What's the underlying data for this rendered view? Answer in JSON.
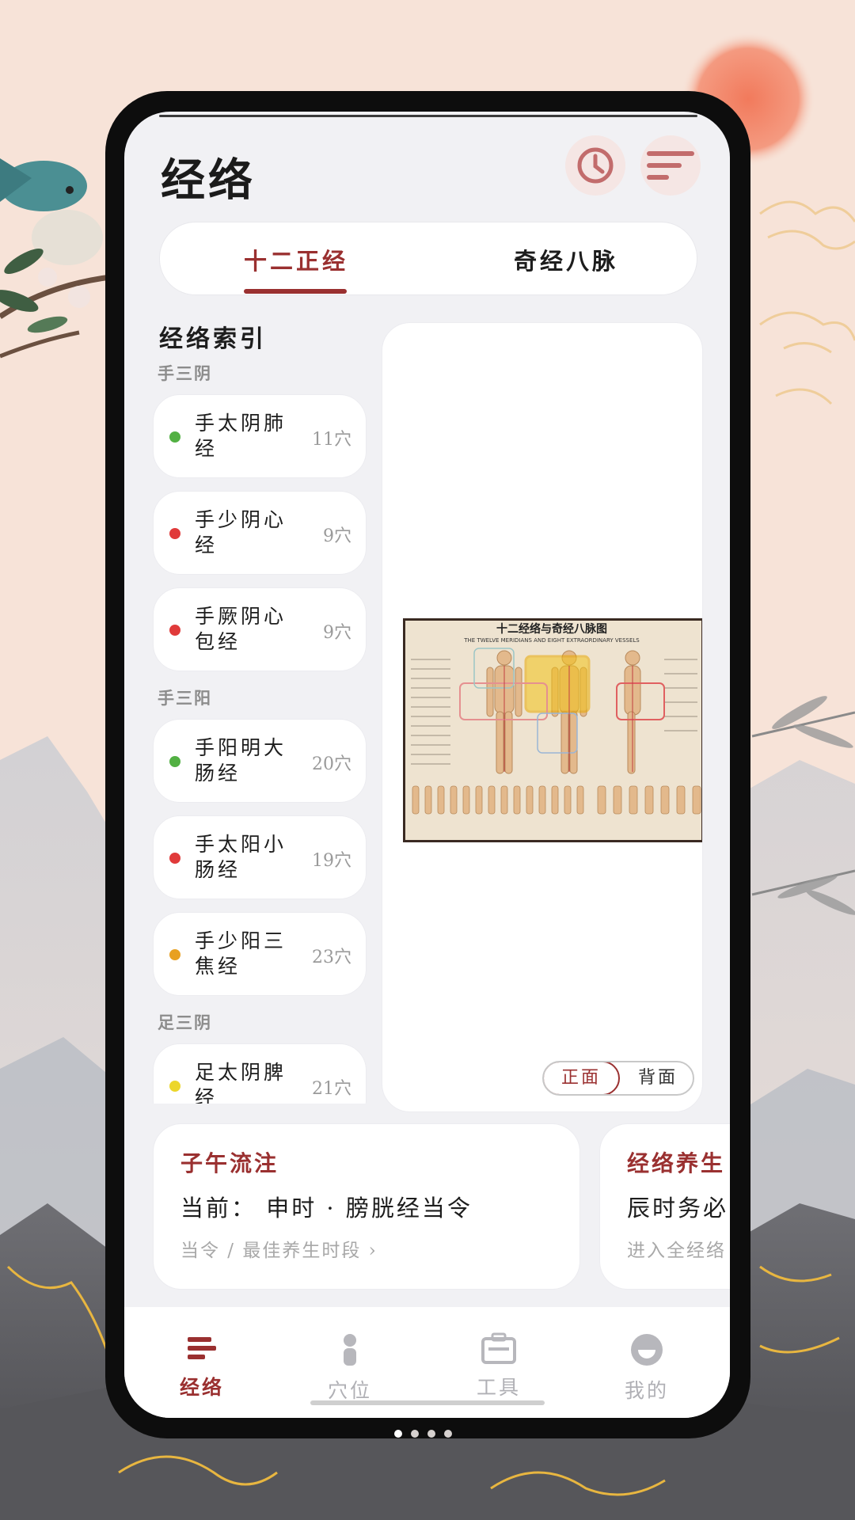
{
  "header": {
    "title": "经络"
  },
  "tabs": [
    {
      "label": "十二正经",
      "active": true
    },
    {
      "label": "奇经八脉",
      "active": false
    }
  ],
  "index": {
    "title": "经络索引",
    "groups": [
      {
        "label": "手三阴",
        "items": [
          {
            "name": "手太阴肺经",
            "count": "11穴",
            "color": "#52b043"
          },
          {
            "name": "手少阴心经",
            "count": "9穴",
            "color": "#e03a3a"
          },
          {
            "name": "手厥阴心包经",
            "count": "9穴",
            "color": "#e03a3a"
          }
        ]
      },
      {
        "label": "手三阳",
        "items": [
          {
            "name": "手阳明大肠经",
            "count": "20穴",
            "color": "#52b043"
          },
          {
            "name": "手太阳小肠经",
            "count": "19穴",
            "color": "#e03a3a"
          },
          {
            "name": "手少阳三焦经",
            "count": "23穴",
            "color": "#e8a020"
          }
        ]
      },
      {
        "label": "足三阴",
        "items": [
          {
            "name": "足太阴脾经",
            "count": "21穴",
            "color": "#ecd62a"
          }
        ]
      }
    ]
  },
  "map": {
    "chart_title": "十二经络与奇经八脉图",
    "chart_subtitle": "THE TWELVE MERIDIANS AND EIGHT EXTRAORDINARY VESSELS",
    "toggle": {
      "front": "正面",
      "back": "背面",
      "selected": "正面"
    }
  },
  "cards": [
    {
      "title": "子午流注",
      "main": "当前：  申时 · 膀胱经当令",
      "sub": "当令 / 最佳养生时段 ›"
    },
    {
      "title": "经络养生",
      "main": "辰时务必",
      "sub": "进入全经络"
    }
  ],
  "bottom_nav": [
    {
      "label": "经络",
      "icon": "meridian-icon",
      "active": true
    },
    {
      "label": "穴位",
      "icon": "acupoint-icon",
      "active": false
    },
    {
      "label": "工具",
      "icon": "toolbox-icon",
      "active": false
    },
    {
      "label": "我的",
      "icon": "profile-icon",
      "active": false
    }
  ],
  "colors": {
    "accent": "#9a3030",
    "background": "#f7e3d8",
    "sun": "#f08a6a"
  }
}
